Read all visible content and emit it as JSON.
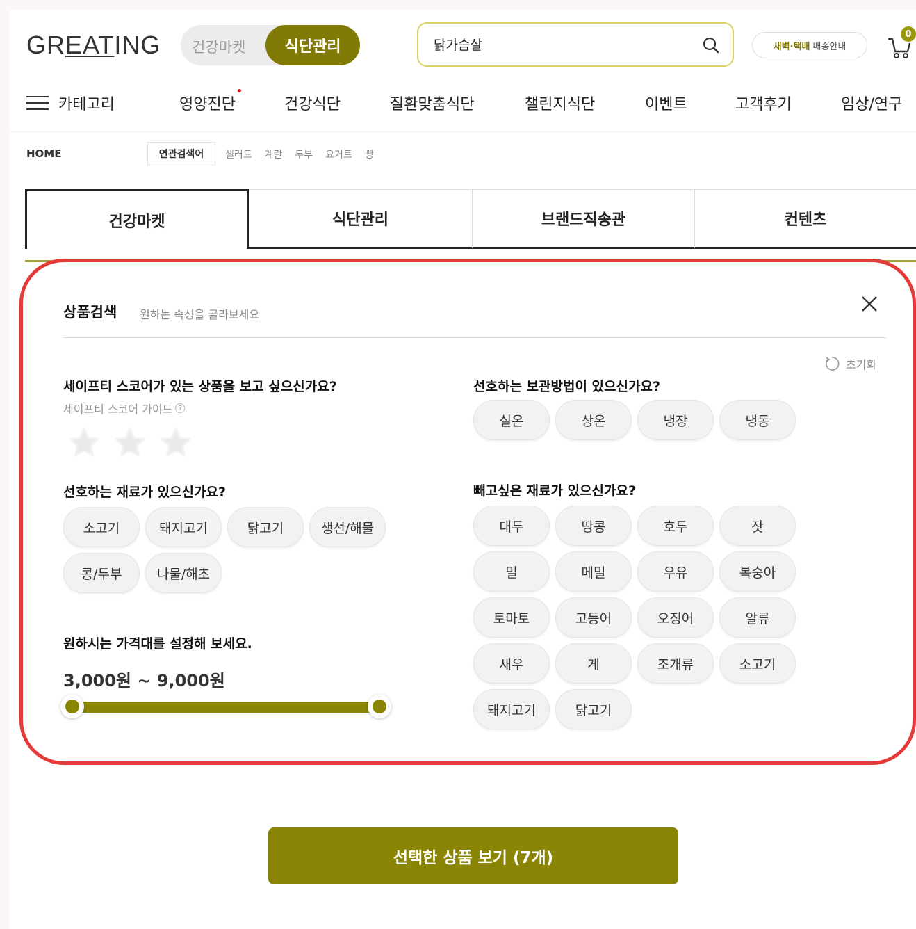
{
  "header": {
    "logo_pre": "GR",
    "logo_ul": "EAT",
    "logo_post": "ING",
    "mode_off": "건강마켓",
    "mode_on": "식단관리",
    "search_value": "닭가슴살",
    "delivery_em": "새벽·택배",
    "delivery_sub": "배송안내",
    "cart_count": "0"
  },
  "nav": {
    "category": "카테고리",
    "items": [
      "영양진단",
      "건강식단",
      "질환맞춤식단",
      "챌린지식단",
      "이벤트",
      "고객후기",
      "임상/연구"
    ]
  },
  "breadcrumb": {
    "home": "HOME",
    "related_label": "연관검색어",
    "related": [
      "샐러드",
      "계란",
      "두부",
      "요거트",
      "빵"
    ]
  },
  "main_tabs": [
    "건강마켓",
    "식단관리",
    "브랜드직송관",
    "컨텐츠"
  ],
  "panel": {
    "title": "상품검색",
    "subtitle": "원하는 속성을 골라보세요",
    "reset": "초기화",
    "safety_q": "세이프티 스코어가 있는 상품을 보고 싶으신가요?",
    "safety_guide": "세이프티 스코어 가이드",
    "stars_total": 3,
    "ingredients_q": "선호하는 재료가 있으신가요?",
    "ingredients": [
      "소고기",
      "돼지고기",
      "닭고기",
      "생선/해물",
      "콩/두부",
      "나물/해초"
    ],
    "price_q": "원하시는 가격대를 설정해 보세요.",
    "price_range": "3,000원 ~ 9,000원",
    "storage_q": "선호하는 보관방법이 있으신가요?",
    "storage": [
      "실온",
      "상온",
      "냉장",
      "냉동"
    ],
    "exclude_q": "빼고싶은 재료가 있으신가요?",
    "exclude": [
      "대두",
      "땅콩",
      "호두",
      "잣",
      "밀",
      "메밀",
      "우유",
      "복숭아",
      "토마토",
      "고등어",
      "오징어",
      "알류",
      "새우",
      "게",
      "조개류",
      "소고기",
      "돼지고기",
      "닭고기"
    ]
  },
  "cta": "선택한 상품 보기 (7개)",
  "colors": {
    "accent": "#827a06",
    "highlight": "#e53a3a"
  }
}
